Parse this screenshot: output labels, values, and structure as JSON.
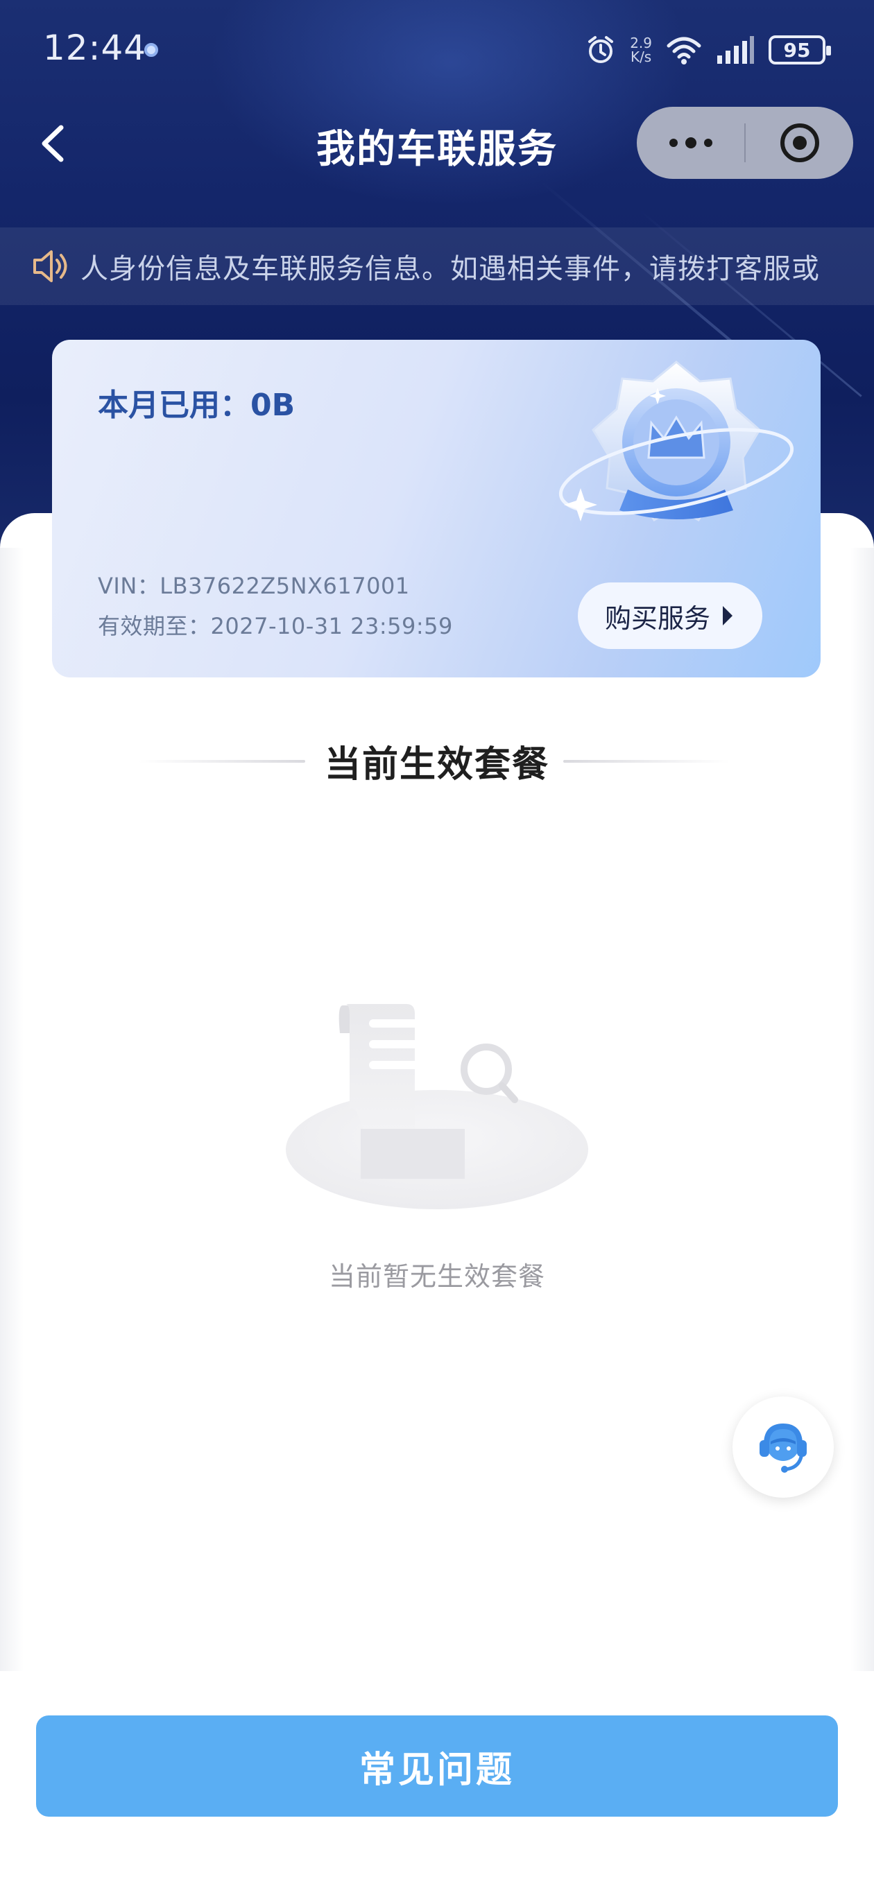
{
  "status_bar": {
    "time": "12:44",
    "net_speed_value": "2.9",
    "net_speed_unit": "K/s",
    "battery": "95"
  },
  "nav": {
    "title": "我的车联服务",
    "back_icon": "chevron-left-icon",
    "more_icon": "more-dots-icon",
    "close_icon": "target-close-icon"
  },
  "notice": {
    "icon": "speaker-icon",
    "text": "人身份信息及车联服务信息。如遇相关事件，请拨打客服或"
  },
  "service_card": {
    "usage_label": "本月已用：",
    "usage_value": "0B",
    "vin_label": "VIN：",
    "vin": "LB37622Z5NX617001",
    "expiry_label": "有效期至：",
    "expiry": "2027-10-31 23:59:59",
    "buy_button": "购买服务"
  },
  "current_plans": {
    "title": "当前生效套餐",
    "empty_text": "当前暂无生效套餐"
  },
  "customer_service": {
    "icon": "customer-service-icon"
  },
  "footer": {
    "faq_button": "常见问题"
  },
  "colors": {
    "header_bg": "#14266a",
    "accent_blue": "#2a52a3",
    "faq_button": "#5aaef3"
  }
}
